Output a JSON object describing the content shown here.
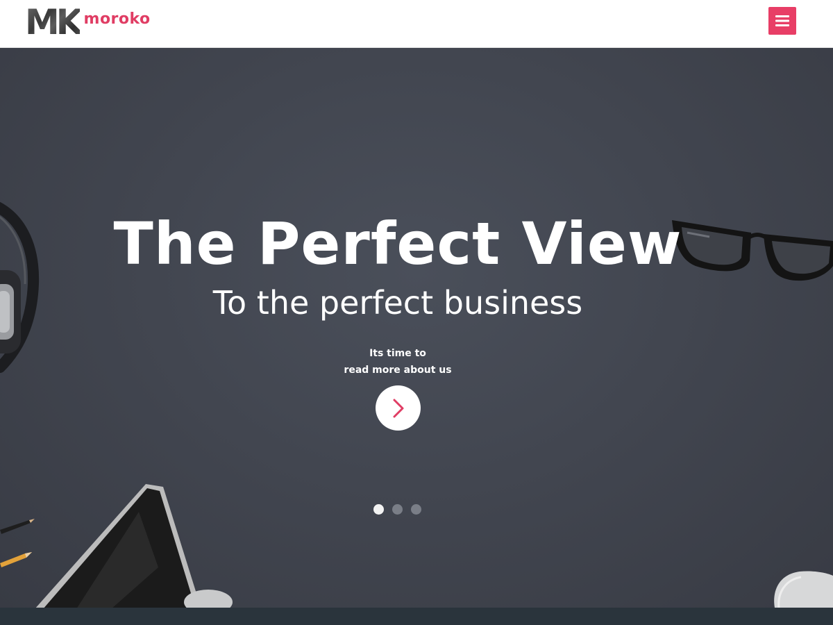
{
  "navbar": {
    "logo_mark": "MK",
    "logo_word": "moroko",
    "menu_icon": "hamburger-icon"
  },
  "hero": {
    "title": "The Perfect View",
    "subtitle": "To the perfect business",
    "cta_line1": "Its time to",
    "cta_line2": "read more about us",
    "cta_icon": "chevron-right-icon",
    "slides": [
      {
        "active": true
      },
      {
        "active": false
      },
      {
        "active": false
      }
    ]
  },
  "colors": {
    "accent": "#e83e66",
    "hero_bg": "#424650",
    "footer_bg": "#2a343c"
  }
}
